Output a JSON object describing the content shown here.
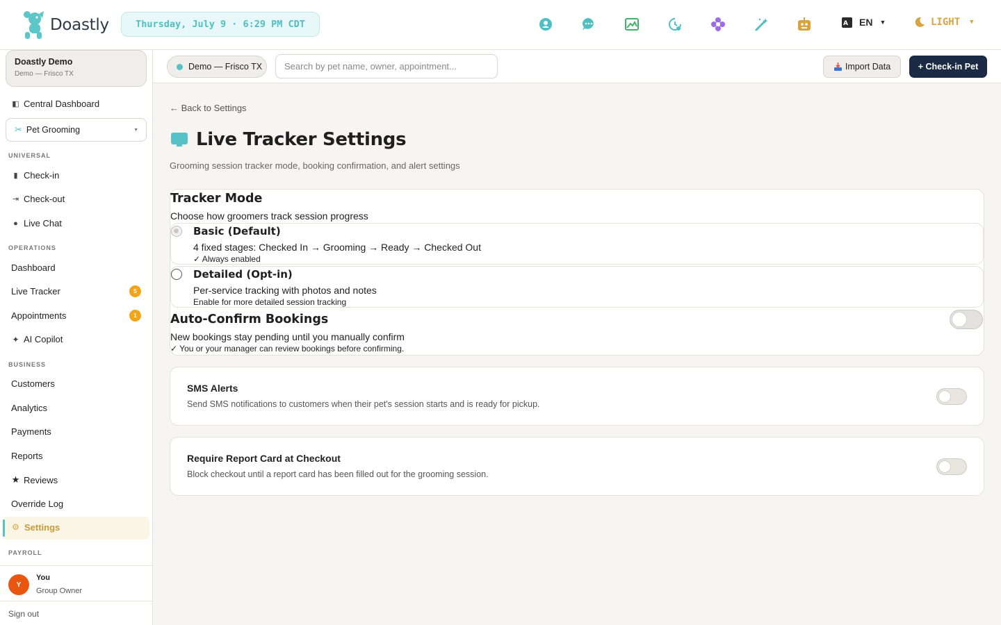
{
  "header": {
    "brand": "Doastly",
    "datetime": "Thursday, July 9 · 6:29 PM CDT",
    "icons": [
      "support-icon",
      "chat-icon",
      "image-icon",
      "history-icon",
      "flower-icon",
      "magic-wand-icon",
      "robot-icon"
    ],
    "language": "EN",
    "theme": "LIGHT"
  },
  "sidebar": {
    "org_name": "Doastly Demo",
    "org_location": "Demo — Frisco TX",
    "central_dashboard": "Central Dashboard",
    "module": "Pet Grooming",
    "sections": {
      "universal": "UNIVERSAL",
      "operations": "OPERATIONS",
      "business": "BUSINESS",
      "payroll": "PAYROLL"
    },
    "universal_items": [
      "Check-in",
      "Check-out",
      "Live Chat"
    ],
    "operations_items": {
      "dashboard": "Dashboard",
      "live_tracker": "Live Tracker",
      "live_tracker_badge": "5",
      "appointments": "Appointments",
      "appointments_badge": "1",
      "ai_copilot": "AI Copilot"
    },
    "business_items": [
      "Customers",
      "Analytics",
      "Payments",
      "Reports",
      "Reviews",
      "Override Log",
      "Settings"
    ],
    "user": {
      "initial": "Y",
      "name": "You",
      "role": "Group Owner"
    },
    "sign_out": "Sign out"
  },
  "subheader": {
    "location": "Demo — Frisco TX",
    "search_placeholder": "Search by pet name, owner, appointment...",
    "import_label": "Import Data",
    "checkin_label": "+ Check-in Pet"
  },
  "main": {
    "back_link": "← Back to Settings",
    "title": "Live Tracker Settings",
    "subtitle": "Grooming session tracker mode, booking confirmation, and alert settings",
    "tracker_mode": {
      "title": "Tracker Mode",
      "description": "Choose how groomers track session progress",
      "options": [
        {
          "title": "Basic (Default)",
          "description": "4 fixed stages: Checked In → Grooming → Ready → Checked Out",
          "note": "✓ Always enabled"
        },
        {
          "title": "Detailed (Opt-in)",
          "description": "Per-service tracking with photos and notes",
          "note": "Enable for more detailed session tracking"
        }
      ]
    },
    "auto_confirm": {
      "title": "Auto-Confirm Bookings",
      "description": "New bookings stay pending until you manually confirm",
      "note": "✓ You or your manager can review bookings before confirming.",
      "enabled": false
    },
    "sms_alerts": {
      "title": "SMS Alerts",
      "description": "Send SMS notifications to customers when their pet's session starts and is ready for pickup.",
      "enabled": false
    },
    "report_card": {
      "title": "Require Report Card at Checkout",
      "description": "Block checkout until a report card has been filled out for the grooming session.",
      "enabled": false
    }
  },
  "colors": {
    "accent_teal": "#56c2c6",
    "brand_navy": "#1b2b45",
    "badge_orange": "#f2a51a",
    "theme_gold": "#d9a43f",
    "avatar_orange": "#e8560f"
  }
}
